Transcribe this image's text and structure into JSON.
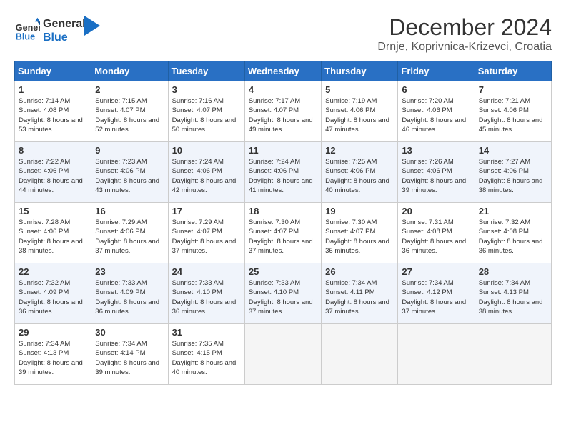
{
  "header": {
    "logo_line1": "General",
    "logo_line2": "Blue",
    "month_title": "December 2024",
    "location": "Drnje, Koprivnica-Krizevci, Croatia"
  },
  "weekdays": [
    "Sunday",
    "Monday",
    "Tuesday",
    "Wednesday",
    "Thursday",
    "Friday",
    "Saturday"
  ],
  "weeks": [
    [
      {
        "day": "1",
        "sunrise": "7:14 AM",
        "sunset": "4:08 PM",
        "daylight": "8 hours and 53 minutes."
      },
      {
        "day": "2",
        "sunrise": "7:15 AM",
        "sunset": "4:07 PM",
        "daylight": "8 hours and 52 minutes."
      },
      {
        "day": "3",
        "sunrise": "7:16 AM",
        "sunset": "4:07 PM",
        "daylight": "8 hours and 50 minutes."
      },
      {
        "day": "4",
        "sunrise": "7:17 AM",
        "sunset": "4:07 PM",
        "daylight": "8 hours and 49 minutes."
      },
      {
        "day": "5",
        "sunrise": "7:19 AM",
        "sunset": "4:06 PM",
        "daylight": "8 hours and 47 minutes."
      },
      {
        "day": "6",
        "sunrise": "7:20 AM",
        "sunset": "4:06 PM",
        "daylight": "8 hours and 46 minutes."
      },
      {
        "day": "7",
        "sunrise": "7:21 AM",
        "sunset": "4:06 PM",
        "daylight": "8 hours and 45 minutes."
      }
    ],
    [
      {
        "day": "8",
        "sunrise": "7:22 AM",
        "sunset": "4:06 PM",
        "daylight": "8 hours and 44 minutes."
      },
      {
        "day": "9",
        "sunrise": "7:23 AM",
        "sunset": "4:06 PM",
        "daylight": "8 hours and 43 minutes."
      },
      {
        "day": "10",
        "sunrise": "7:24 AM",
        "sunset": "4:06 PM",
        "daylight": "8 hours and 42 minutes."
      },
      {
        "day": "11",
        "sunrise": "7:24 AM",
        "sunset": "4:06 PM",
        "daylight": "8 hours and 41 minutes."
      },
      {
        "day": "12",
        "sunrise": "7:25 AM",
        "sunset": "4:06 PM",
        "daylight": "8 hours and 40 minutes."
      },
      {
        "day": "13",
        "sunrise": "7:26 AM",
        "sunset": "4:06 PM",
        "daylight": "8 hours and 39 minutes."
      },
      {
        "day": "14",
        "sunrise": "7:27 AM",
        "sunset": "4:06 PM",
        "daylight": "8 hours and 38 minutes."
      }
    ],
    [
      {
        "day": "15",
        "sunrise": "7:28 AM",
        "sunset": "4:06 PM",
        "daylight": "8 hours and 38 minutes."
      },
      {
        "day": "16",
        "sunrise": "7:29 AM",
        "sunset": "4:06 PM",
        "daylight": "8 hours and 37 minutes."
      },
      {
        "day": "17",
        "sunrise": "7:29 AM",
        "sunset": "4:07 PM",
        "daylight": "8 hours and 37 minutes."
      },
      {
        "day": "18",
        "sunrise": "7:30 AM",
        "sunset": "4:07 PM",
        "daylight": "8 hours and 37 minutes."
      },
      {
        "day": "19",
        "sunrise": "7:30 AM",
        "sunset": "4:07 PM",
        "daylight": "8 hours and 36 minutes."
      },
      {
        "day": "20",
        "sunrise": "7:31 AM",
        "sunset": "4:08 PM",
        "daylight": "8 hours and 36 minutes."
      },
      {
        "day": "21",
        "sunrise": "7:32 AM",
        "sunset": "4:08 PM",
        "daylight": "8 hours and 36 minutes."
      }
    ],
    [
      {
        "day": "22",
        "sunrise": "7:32 AM",
        "sunset": "4:09 PM",
        "daylight": "8 hours and 36 minutes."
      },
      {
        "day": "23",
        "sunrise": "7:33 AM",
        "sunset": "4:09 PM",
        "daylight": "8 hours and 36 minutes."
      },
      {
        "day": "24",
        "sunrise": "7:33 AM",
        "sunset": "4:10 PM",
        "daylight": "8 hours and 36 minutes."
      },
      {
        "day": "25",
        "sunrise": "7:33 AM",
        "sunset": "4:10 PM",
        "daylight": "8 hours and 37 minutes."
      },
      {
        "day": "26",
        "sunrise": "7:34 AM",
        "sunset": "4:11 PM",
        "daylight": "8 hours and 37 minutes."
      },
      {
        "day": "27",
        "sunrise": "7:34 AM",
        "sunset": "4:12 PM",
        "daylight": "8 hours and 37 minutes."
      },
      {
        "day": "28",
        "sunrise": "7:34 AM",
        "sunset": "4:13 PM",
        "daylight": "8 hours and 38 minutes."
      }
    ],
    [
      {
        "day": "29",
        "sunrise": "7:34 AM",
        "sunset": "4:13 PM",
        "daylight": "8 hours and 39 minutes."
      },
      {
        "day": "30",
        "sunrise": "7:34 AM",
        "sunset": "4:14 PM",
        "daylight": "8 hours and 39 minutes."
      },
      {
        "day": "31",
        "sunrise": "7:35 AM",
        "sunset": "4:15 PM",
        "daylight": "8 hours and 40 minutes."
      },
      null,
      null,
      null,
      null
    ]
  ],
  "labels": {
    "sunrise_prefix": "Sunrise: ",
    "sunset_prefix": "Sunset: ",
    "daylight_prefix": "Daylight: "
  }
}
